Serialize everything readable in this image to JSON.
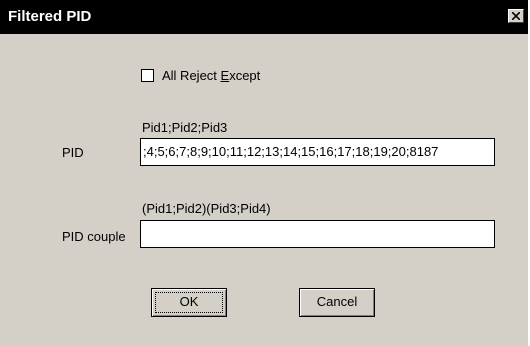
{
  "window": {
    "title": "Filtered PID",
    "close_glyph": "close-icon"
  },
  "checkbox": {
    "label_pre": "All Reject ",
    "label_hot": "E",
    "label_post": "xcept",
    "checked": false
  },
  "pid": {
    "hint": "Pid1;Pid2;Pid3",
    "label": "PID",
    "value": ";4;5;6;7;8;9;10;11;12;13;14;15;16;17;18;19;20;8187"
  },
  "pid_couple": {
    "hint": "(Pid1;Pid2)(Pid3;Pid4)",
    "label": "PID couple",
    "value": ""
  },
  "buttons": {
    "ok": "OK",
    "cancel": "Cancel"
  }
}
